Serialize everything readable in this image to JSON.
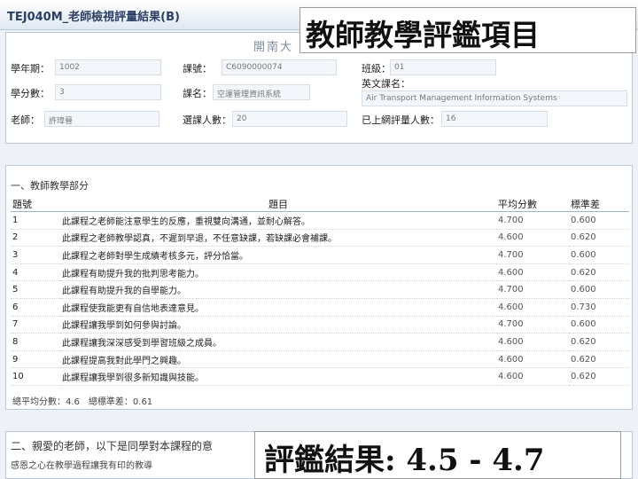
{
  "app": {
    "title": "TEJ040M_老師檢視評量結果(B)"
  },
  "overlay": {
    "title": "教師教學評鑑項目",
    "result": "評鑑結果: 4.5 - 4.7"
  },
  "course_panel": {
    "header": "開南大",
    "fields": {
      "semester_label": "學年期：",
      "semester_value": "1002",
      "course_code_label": "課號：",
      "course_code_value": "C6090000074",
      "class_label": "班級：",
      "class_value": "01",
      "credits_label": "學分數：",
      "credits_value": "3",
      "course_name_label": "課名：",
      "course_name_value": "空運管理資訊系統",
      "english_name_label": "英文課名：",
      "english_name_value": "Air Transport Management Information Systems",
      "teacher_label": "老師：",
      "teacher_value": "許瑋晉",
      "enrolled_label": "選課人數：",
      "enrolled_value": "20",
      "evaluated_label": "已上網評量人數：",
      "evaluated_value": "16"
    }
  },
  "section1": {
    "title": "一、教師教學部分",
    "columns": {
      "no": "題號",
      "item": "題目",
      "avg": "平均分數",
      "std": "標準差"
    },
    "rows": [
      {
        "no": "1",
        "item": "此課程之老師能注意學生的反應，重視雙向溝通，並耐心解答。",
        "avg": "4.700",
        "std": "0.600"
      },
      {
        "no": "2",
        "item": "此課程之老師教學認真，不遲到早退，不任意缺課，若缺課必會補課。",
        "avg": "4.600",
        "std": "0.620"
      },
      {
        "no": "3",
        "item": "此課程之老師對學生成績考核多元，評分恰當。",
        "avg": "4.700",
        "std": "0.600"
      },
      {
        "no": "4",
        "item": "此課程有助提升我的批判思考能力。",
        "avg": "4.600",
        "std": "0.620"
      },
      {
        "no": "5",
        "item": "此課程有助提升我的自學能力。",
        "avg": "4.700",
        "std": "0.600"
      },
      {
        "no": "6",
        "item": "此課程使我能更有自信地表達意見。",
        "avg": "4.600",
        "std": "0.730"
      },
      {
        "no": "7",
        "item": "此課程讓我學到如何參與討論。",
        "avg": "4.700",
        "std": "0.600"
      },
      {
        "no": "8",
        "item": "此課程讓我深深感受到學習班級之成員。",
        "avg": "4.600",
        "std": "0.620"
      },
      {
        "no": "9",
        "item": "此課程提高我對此學門之興趣。",
        "avg": "4.600",
        "std": "0.620"
      },
      {
        "no": "10",
        "item": "此課程讓我學到很多新知識與技能。",
        "avg": "4.600",
        "std": "0.620"
      }
    ],
    "summary": "總平均分數：4.6　總標準差：0.61"
  },
  "section2": {
    "title": "二、親愛的老師，以下是同學對本課程的意",
    "subtitle": "感恩之心在教學過程讓我有印的教導"
  }
}
